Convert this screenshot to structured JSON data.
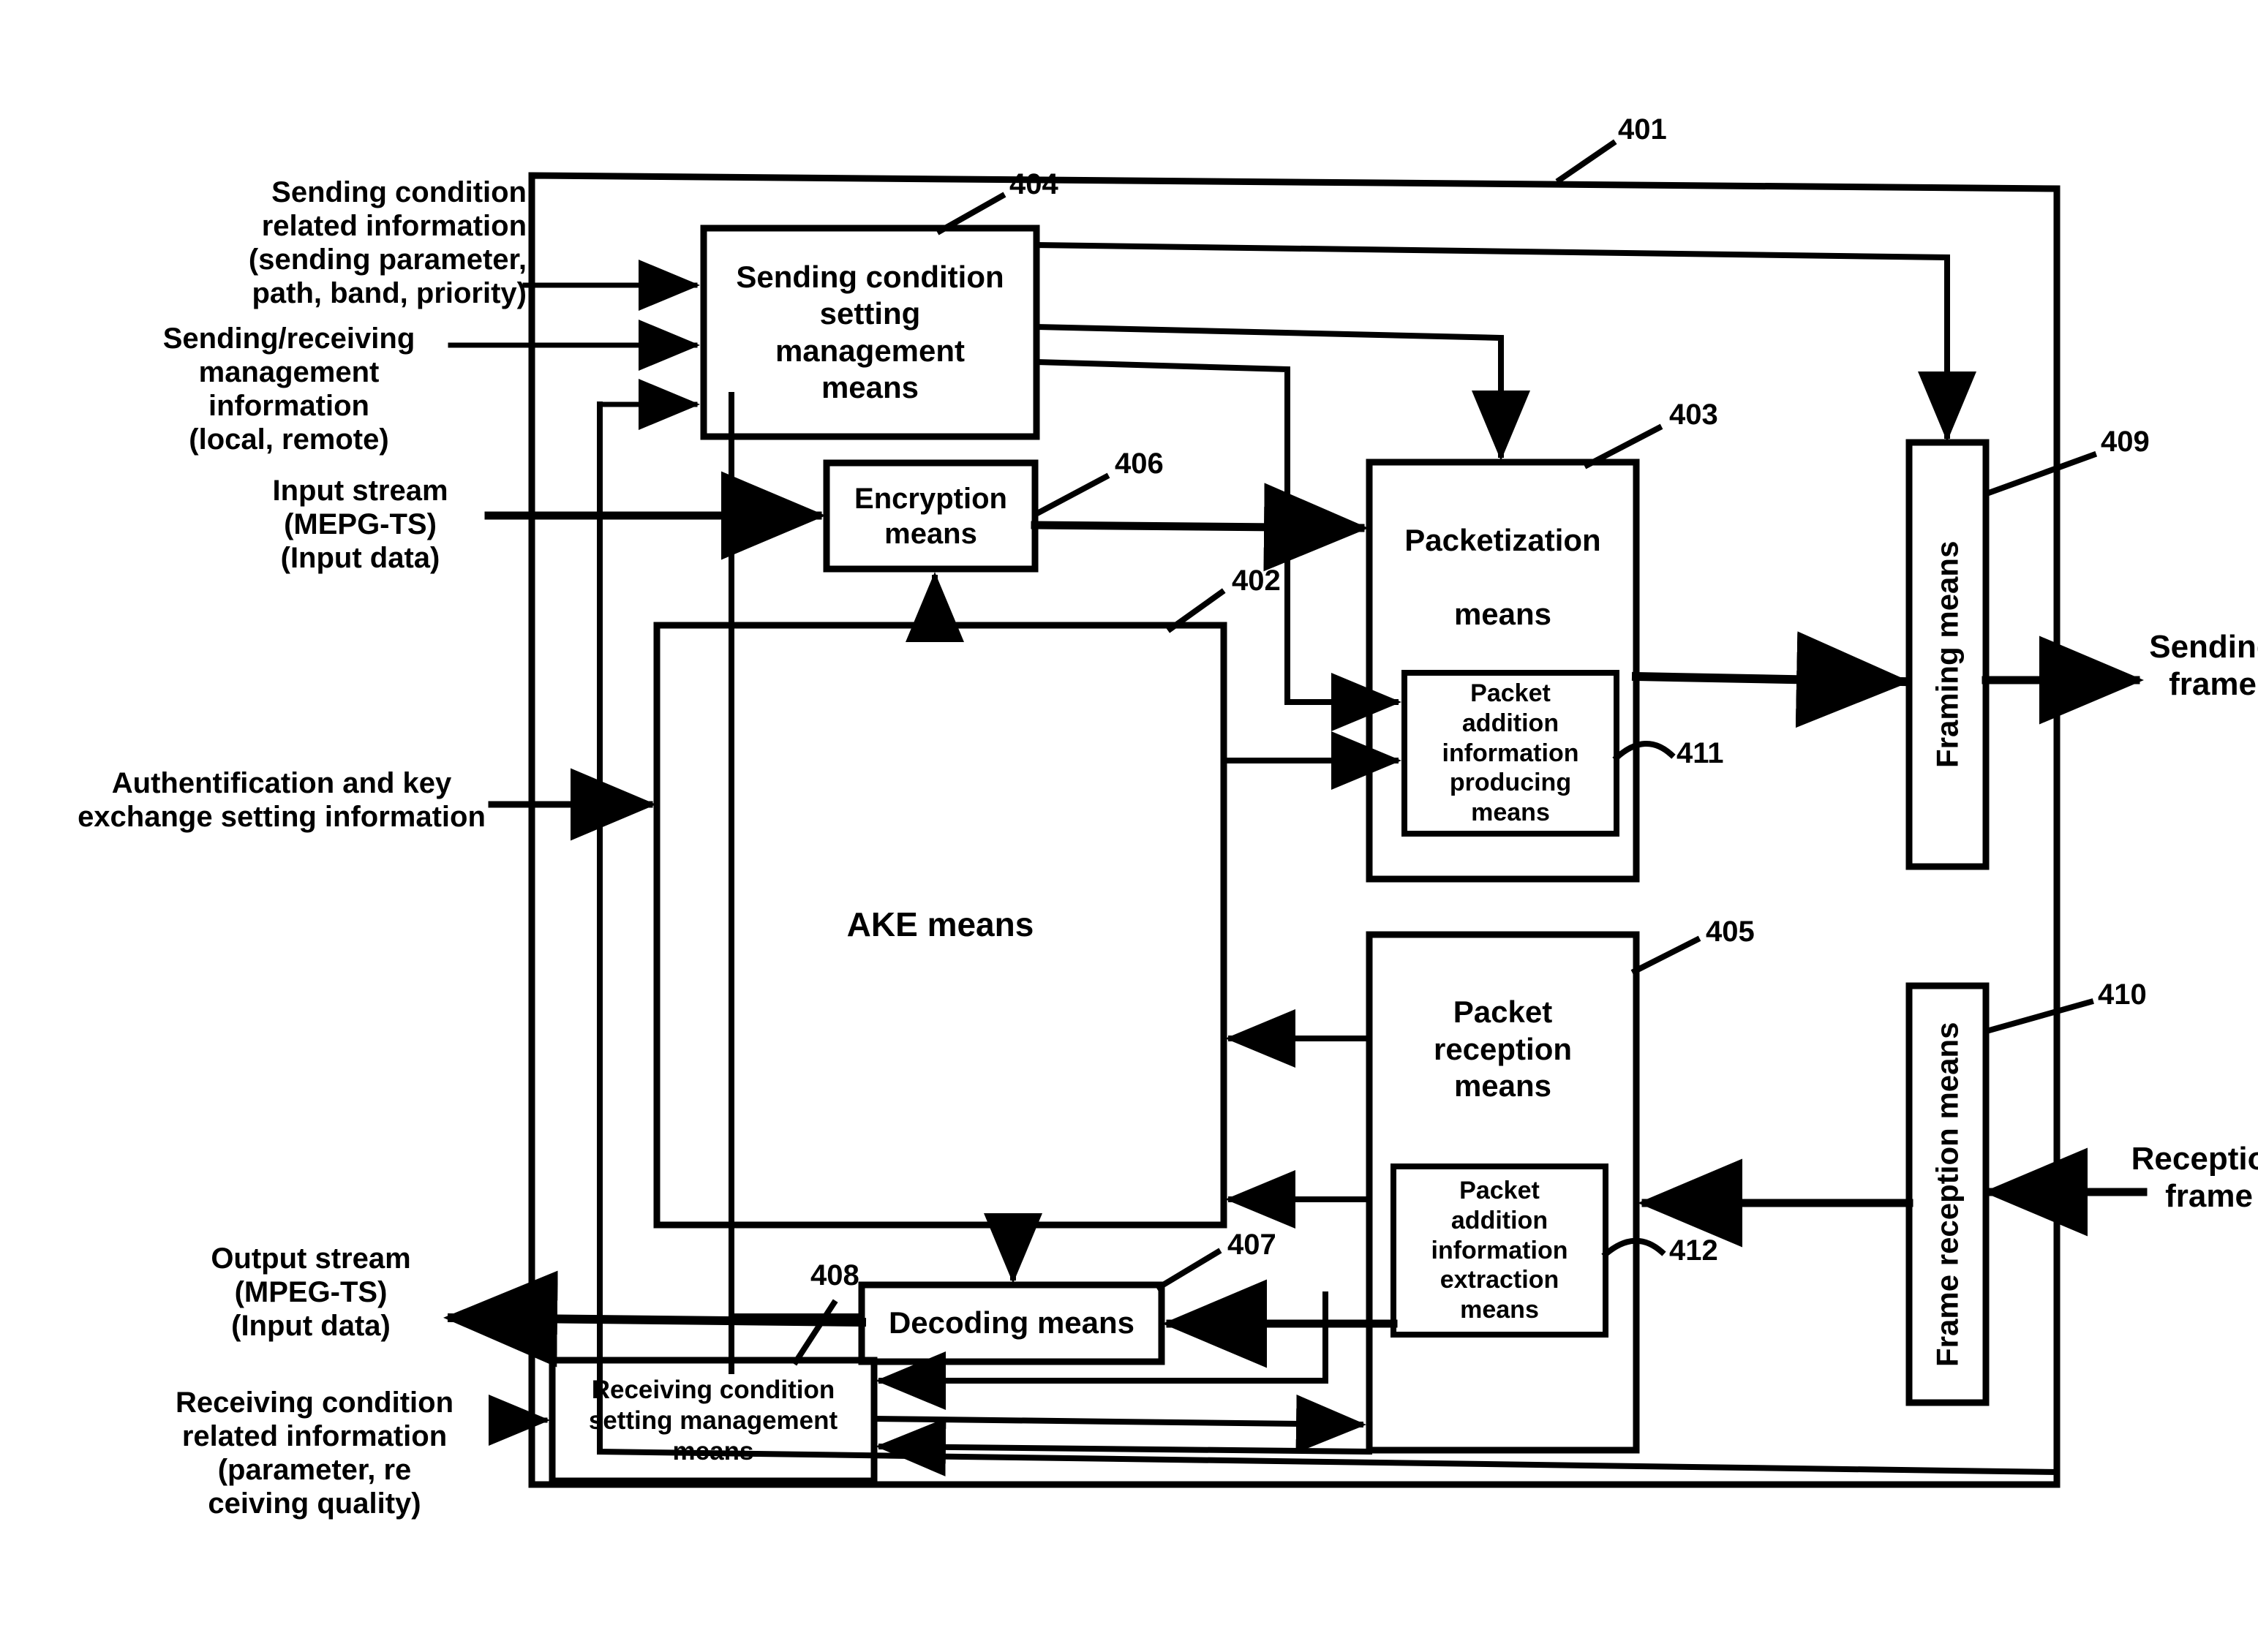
{
  "figure": {
    "type": "patent-block-diagram",
    "background": "#ffffff",
    "stroke": "#000000"
  },
  "external_labels": {
    "sending_condition_info": "Sending condition\nrelated information\n(sending parameter,\npath, band, priority)",
    "sending_receiving_mgmt_info": "Sending/receiving\nmanagement\ninformation\n(local, remote)",
    "input_stream": "Input stream\n(MEPG-TS)\n(Input data)",
    "auth_key_exchange": "Authentification and key\nexchange setting information",
    "output_stream": "Output stream\n(MPEG-TS)\n(Input data)",
    "receiving_condition_info": "Receiving condition\nrelated information\n(parameter, re\nceiving quality)",
    "sending_frame": "Sending\nframe",
    "reception_frame": "Reception\nframe"
  },
  "blocks": {
    "outer": {
      "ref": "401",
      "label": ""
    },
    "ake": {
      "ref": "402",
      "label": "AKE means"
    },
    "packetization": {
      "ref": "403",
      "label": "Packetization\n\nmeans"
    },
    "sending_condition": {
      "ref": "404",
      "label": "Sending condition\nsetting\nmanagement\nmeans"
    },
    "packet_reception": {
      "ref": "405",
      "label": "Packet\nreception\nmeans"
    },
    "encryption": {
      "ref": "406",
      "label": "Encryption\nmeans"
    },
    "decoding": {
      "ref": "407",
      "label": "Decoding means"
    },
    "receiving_condition": {
      "ref": "408",
      "label": "Receiving condition\nsetting management\nmeans"
    },
    "framing": {
      "ref": "409",
      "label": "Framing means"
    },
    "frame_reception": {
      "ref": "410",
      "label": "Frame reception means"
    },
    "packet_addition_producing": {
      "ref": "411",
      "label": "Packet\naddition\ninformation\nproducing\nmeans"
    },
    "packet_addition_extraction": {
      "ref": "412",
      "label": "Packet\naddition\ninformation\nextraction\nmeans"
    }
  },
  "reference_numerals": [
    "401",
    "402",
    "403",
    "404",
    "405",
    "406",
    "407",
    "408",
    "409",
    "410",
    "411",
    "412"
  ]
}
